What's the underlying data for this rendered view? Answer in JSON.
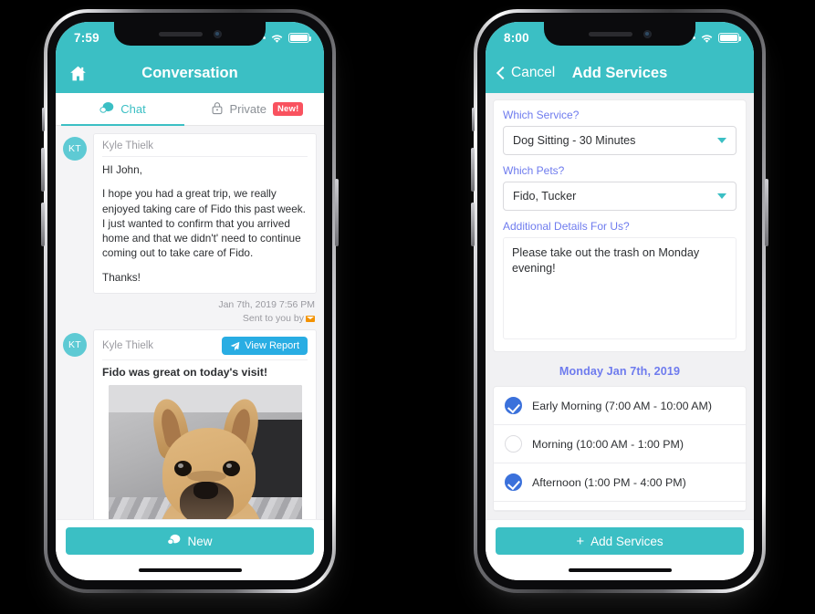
{
  "phones": {
    "left": {
      "status": {
        "time": "7:59",
        "wifi_icon": "wifi-icon",
        "battery_icon": "battery-icon",
        "signal_icon": "signal-dots-icon"
      },
      "navbar": {
        "home_icon": "home-icon",
        "title": "Conversation"
      },
      "tabs": [
        {
          "label": "Chat",
          "icon": "chat-bubble-icon",
          "active": true,
          "badge": ""
        },
        {
          "label": "Private",
          "icon": "lock-icon",
          "active": false,
          "badge": "New!"
        }
      ],
      "messages": [
        {
          "avatar_initials": "KT",
          "sender": "Kyle Thielk",
          "paragraphs": [
            "HI John,",
            "I hope you had a great trip, we really enjoyed taking care of Fido this past week. I just wanted to confirm that you arrived home and that we didn't' need to continue coming out to take care of Fido.",
            "Thanks!"
          ],
          "timestamp": "Jan 7th, 2019 7:56 PM",
          "sent_by": "Sent to you by",
          "sent_by_icon": "email-icon"
        },
        {
          "avatar_initials": "KT",
          "sender": "Kyle Thielk",
          "action_label": "View Report",
          "action_icon": "paper-plane-icon",
          "caption": "Fido was great on today's visit!",
          "photo_alt": "french-bulldog-photo"
        }
      ],
      "bottom_button": {
        "label": "New",
        "icon": "chat-bubble-icon"
      }
    },
    "right": {
      "status": {
        "time": "8:00",
        "wifi_icon": "wifi-icon",
        "battery_icon": "battery-icon",
        "signal_icon": "signal-dots-icon"
      },
      "navbar": {
        "back_label": "Cancel",
        "back_icon": "chevron-left-icon",
        "title": "Add Services"
      },
      "form": {
        "service": {
          "label": "Which Service?",
          "value": "Dog Sitting - 30 Minutes",
          "caret_icon": "caret-down-icon"
        },
        "pets": {
          "label": "Which Pets?",
          "value": "Fido, Tucker",
          "caret_icon": "caret-down-icon"
        },
        "details": {
          "label": "Additional Details For Us?",
          "value": "Please take out the trash on Monday evening!"
        }
      },
      "date_heading": "Monday Jan 7th, 2019",
      "slots": [
        {
          "label": "Early Morning (7:00 AM - 10:00 AM)",
          "checked": true
        },
        {
          "label": "Morning (10:00 AM - 1:00 PM)",
          "checked": false
        },
        {
          "label": "Afternoon (1:00 PM - 4:00 PM)",
          "checked": true
        }
      ],
      "bottom_button": {
        "label": "Add Services",
        "icon": "plus-icon"
      }
    }
  },
  "colors": {
    "teal": "#3BBFC4",
    "blue_action": "#29ADE3",
    "indigo_label": "#6E7BEE",
    "radio_blue": "#3B71DB",
    "badge_red": "#F9525F",
    "page_bg": "#000000"
  }
}
